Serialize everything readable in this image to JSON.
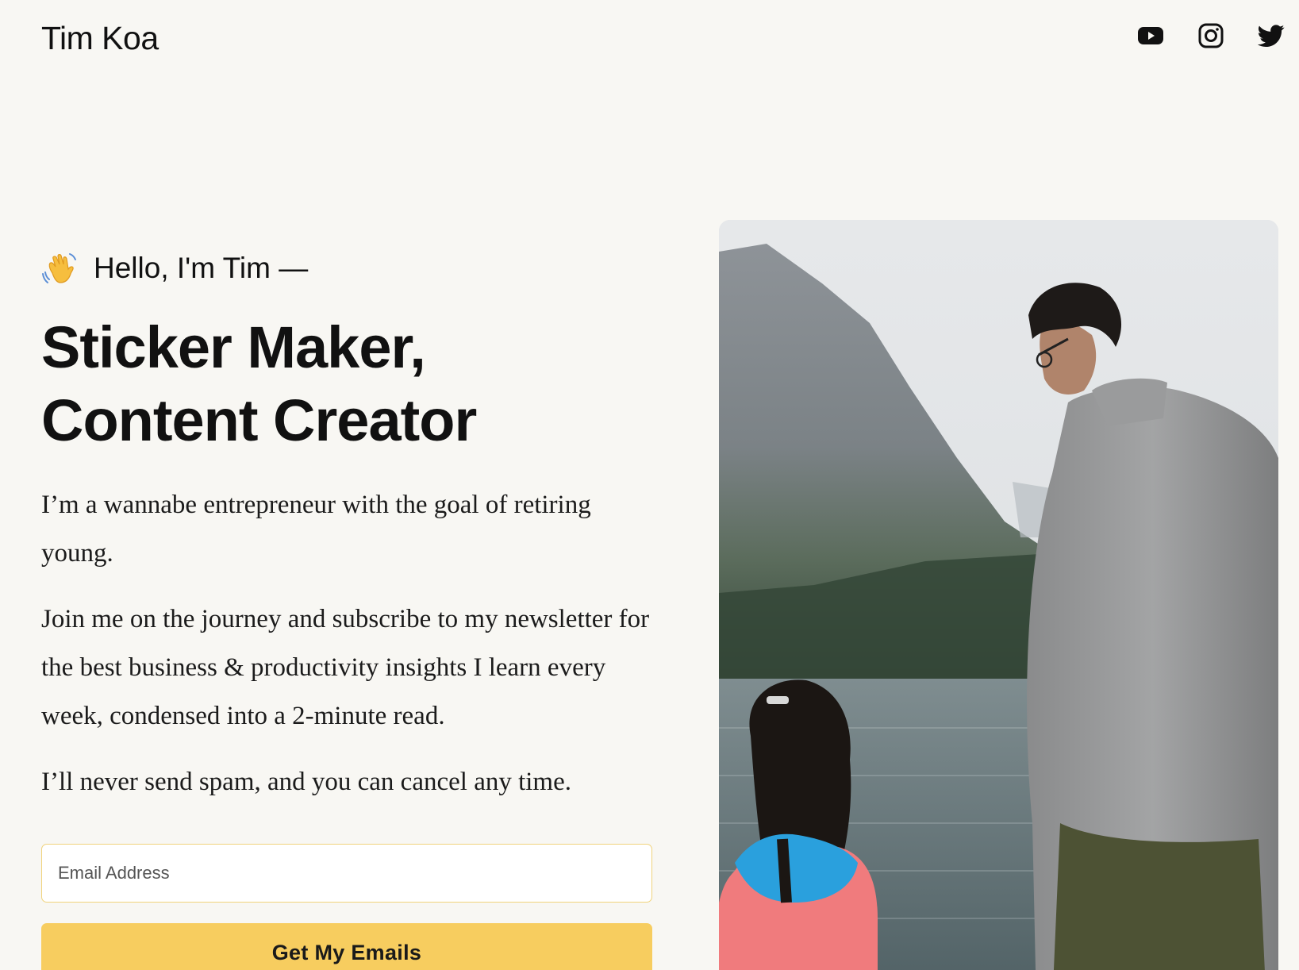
{
  "header": {
    "logo": "Tim Koa",
    "social": [
      {
        "name": "youtube-icon"
      },
      {
        "name": "instagram-icon"
      },
      {
        "name": "twitter-icon"
      }
    ]
  },
  "hero": {
    "greeting": "Hello, I'm Tim —",
    "headline_line1": "Sticker Maker,",
    "headline_line2": "Content Creator",
    "paragraph1": "I’m a wannabe entrepreneur with the goal of retiring young.",
    "paragraph2": "Join me on the journey and subscribe to my newsletter for the best business & productivity insights I learn every week, condensed into a 2-minute read.",
    "paragraph3": "I’ll never send spam, and you can cancel any time.",
    "email_placeholder": "Email Address",
    "email_value": "",
    "cta_label": "Get My Emails"
  },
  "colors": {
    "background": "#f8f7f3",
    "accent": "#f7cd5f",
    "input_border": "#f0d37c",
    "text": "#111111"
  }
}
